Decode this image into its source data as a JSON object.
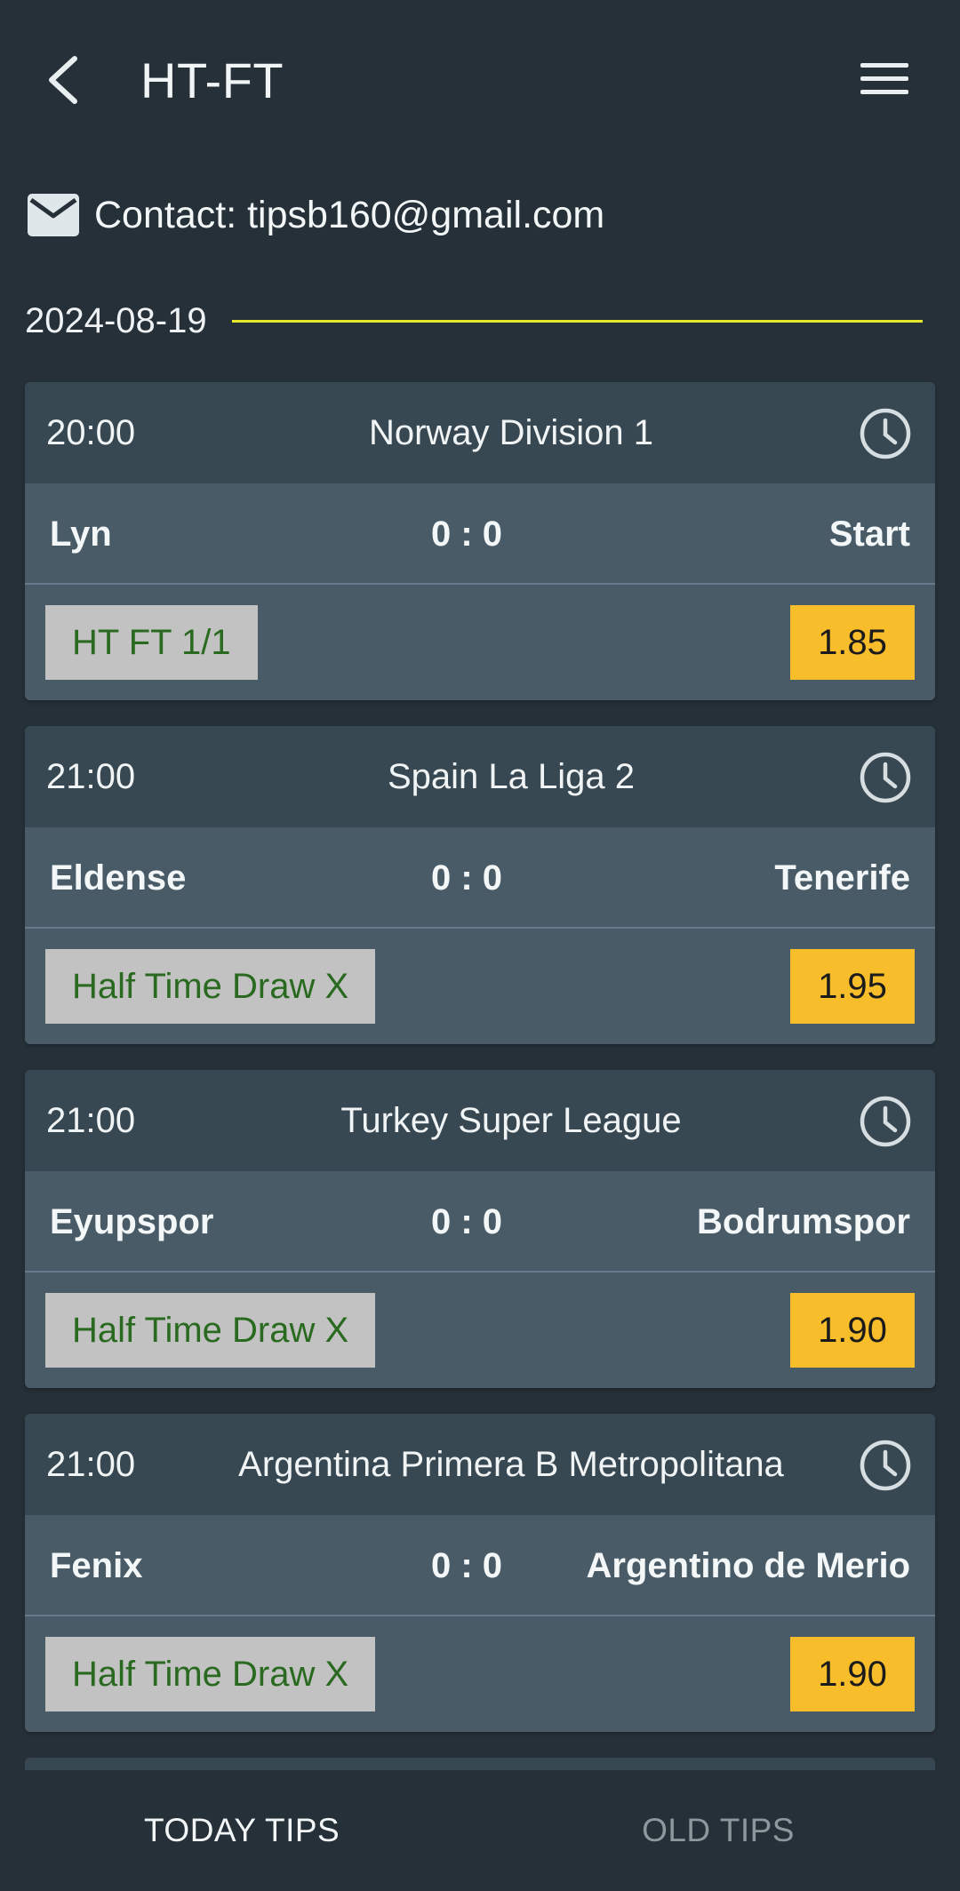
{
  "header": {
    "title": "HT-FT",
    "back_icon": "chevron-left-icon",
    "menu_icon": "hamburger-menu-icon"
  },
  "contact": {
    "icon": "mail-icon",
    "text": "Contact: tipsb160@gmail.com"
  },
  "date": {
    "label": "2024-08-19",
    "line_color": "#e6e62a"
  },
  "matches": [
    {
      "time": "20:00",
      "league": "Norway Division 1",
      "home": "Lyn",
      "score": "0 : 0",
      "away": "Start",
      "tip": "HT FT 1/1",
      "odds": "1.85"
    },
    {
      "time": "21:00",
      "league": "Spain La Liga 2",
      "home": "Eldense",
      "score": "0 : 0",
      "away": "Tenerife",
      "tip": "Half Time Draw X",
      "odds": "1.95"
    },
    {
      "time": "21:00",
      "league": "Turkey Super League",
      "home": "Eyupspor",
      "score": "0 : 0",
      "away": "Bodrumspor",
      "tip": "Half Time Draw X",
      "odds": "1.90"
    },
    {
      "time": "21:00",
      "league": "Argentina Primera B Metropolitana",
      "home": "Fenix",
      "score": "0 : 0",
      "away": "Argentino de Merio",
      "tip": "Half Time Draw X",
      "odds": "1.90"
    }
  ],
  "colors": {
    "background": "#263038",
    "card_header": "#384852",
    "card_body": "#485b67",
    "tip_bg": "#c2c2c2",
    "tip_text": "#2a6a20",
    "odds_bg": "#f7bd2b"
  },
  "bottom_nav": {
    "tabs": [
      {
        "label": "TODAY TIPS",
        "active": true
      },
      {
        "label": "OLD TIPS",
        "active": false
      }
    ]
  }
}
